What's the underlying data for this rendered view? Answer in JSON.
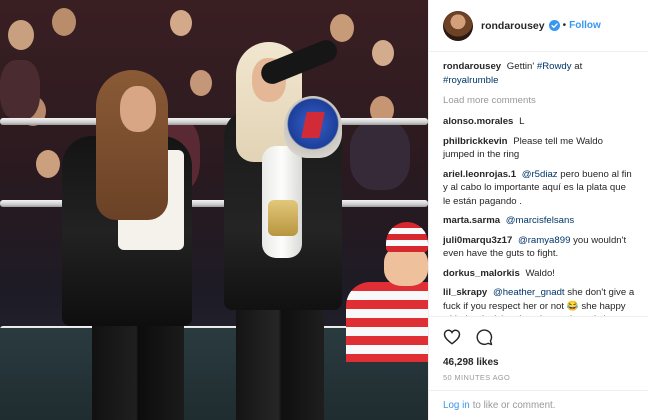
{
  "header": {
    "username": "rondarousey",
    "dot": "•",
    "follow_label": "Follow"
  },
  "caption": {
    "author": "rondarousey",
    "text": "Gettin'",
    "hashtag1": "#Rowdy",
    "middle": "at",
    "hashtag2": "#royalrumble"
  },
  "load_more_label": "Load more comments",
  "comments": [
    {
      "author": "alonso.morales",
      "mention": "",
      "text": "L"
    },
    {
      "author": "philbrickkevin",
      "mention": "",
      "text": "Please tell me Waldo jumped in the ring"
    },
    {
      "author": "ariel.leonrojas.1",
      "mention": "@r5diaz",
      "text": "pero bueno al fin y al cabo lo importante aquí es la plata que le están pagando ."
    },
    {
      "author": "marta.sarma",
      "mention": "@marcisfelsans",
      "text": ""
    },
    {
      "author": "juli0marqu3z17",
      "mention": "@ramya899",
      "text": "you wouldn't even have the guts to fight."
    },
    {
      "author": "dorkus_malorkis",
      "mention": "",
      "text": "Waldo!"
    },
    {
      "author": "lil_skrapy",
      "mention": "@heather_gnadt",
      "text": "she don't give a fuck if you respect her or not 😂 she happy with the decision that she made and she got a bank account that's bigger than all of yours combined 😎 and there will always be"
    }
  ],
  "likes": "46,298 likes",
  "time_ago": "50 MINUTES AGO",
  "login": {
    "link_label": "Log in",
    "rest": "to like or comment."
  },
  "icons": {
    "like": "heart-outline-icon",
    "comment": "speech-bubble-icon",
    "verified": "verified-badge-icon"
  },
  "colors": {
    "accent": "#3897f0",
    "mention": "#003569",
    "muted": "#999999"
  }
}
